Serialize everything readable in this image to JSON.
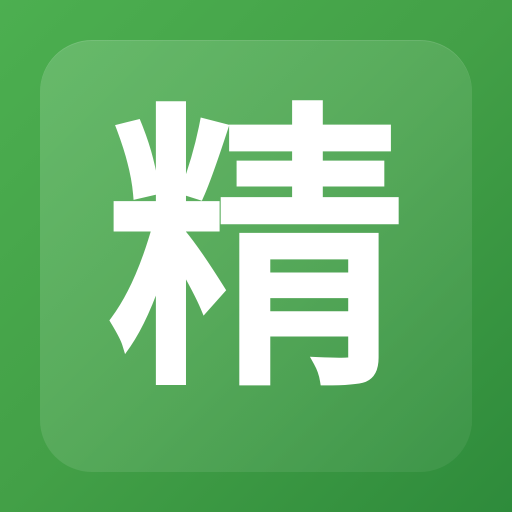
{
  "icon": {
    "glyph": "精",
    "colors": {
      "background_start": "#4caf50",
      "background_end": "#2e8b3b",
      "glyph": "#ffffff"
    }
  }
}
